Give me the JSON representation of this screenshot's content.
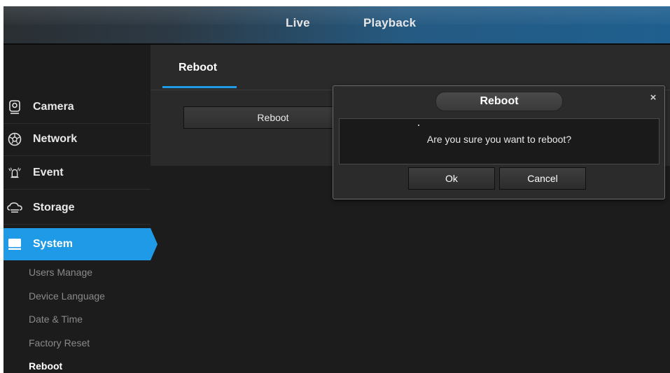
{
  "top_nav": {
    "live": "Live",
    "playback": "Playback"
  },
  "sidebar": {
    "items": [
      {
        "label": "Camera",
        "icon": "camera-icon"
      },
      {
        "label": "Network",
        "icon": "network-icon"
      },
      {
        "label": "Event",
        "icon": "event-icon"
      },
      {
        "label": "Storage",
        "icon": "storage-icon"
      },
      {
        "label": "System",
        "icon": "system-icon",
        "active": true
      }
    ],
    "sub_items": [
      "Users Manage",
      "Device Language",
      "Date & Time",
      "Factory Reset",
      "Reboot"
    ],
    "current_sub": "Reboot"
  },
  "panel": {
    "tab": "Reboot",
    "button": "Reboot"
  },
  "dialog": {
    "title": "Reboot",
    "close": "×",
    "message": "Are you sure you want to reboot?",
    "ok": "Ok",
    "cancel": "Cancel"
  },
  "colors": {
    "accent": "#1e9ae6",
    "background": "#1c1c1c",
    "panel": "#2a2a2a"
  }
}
